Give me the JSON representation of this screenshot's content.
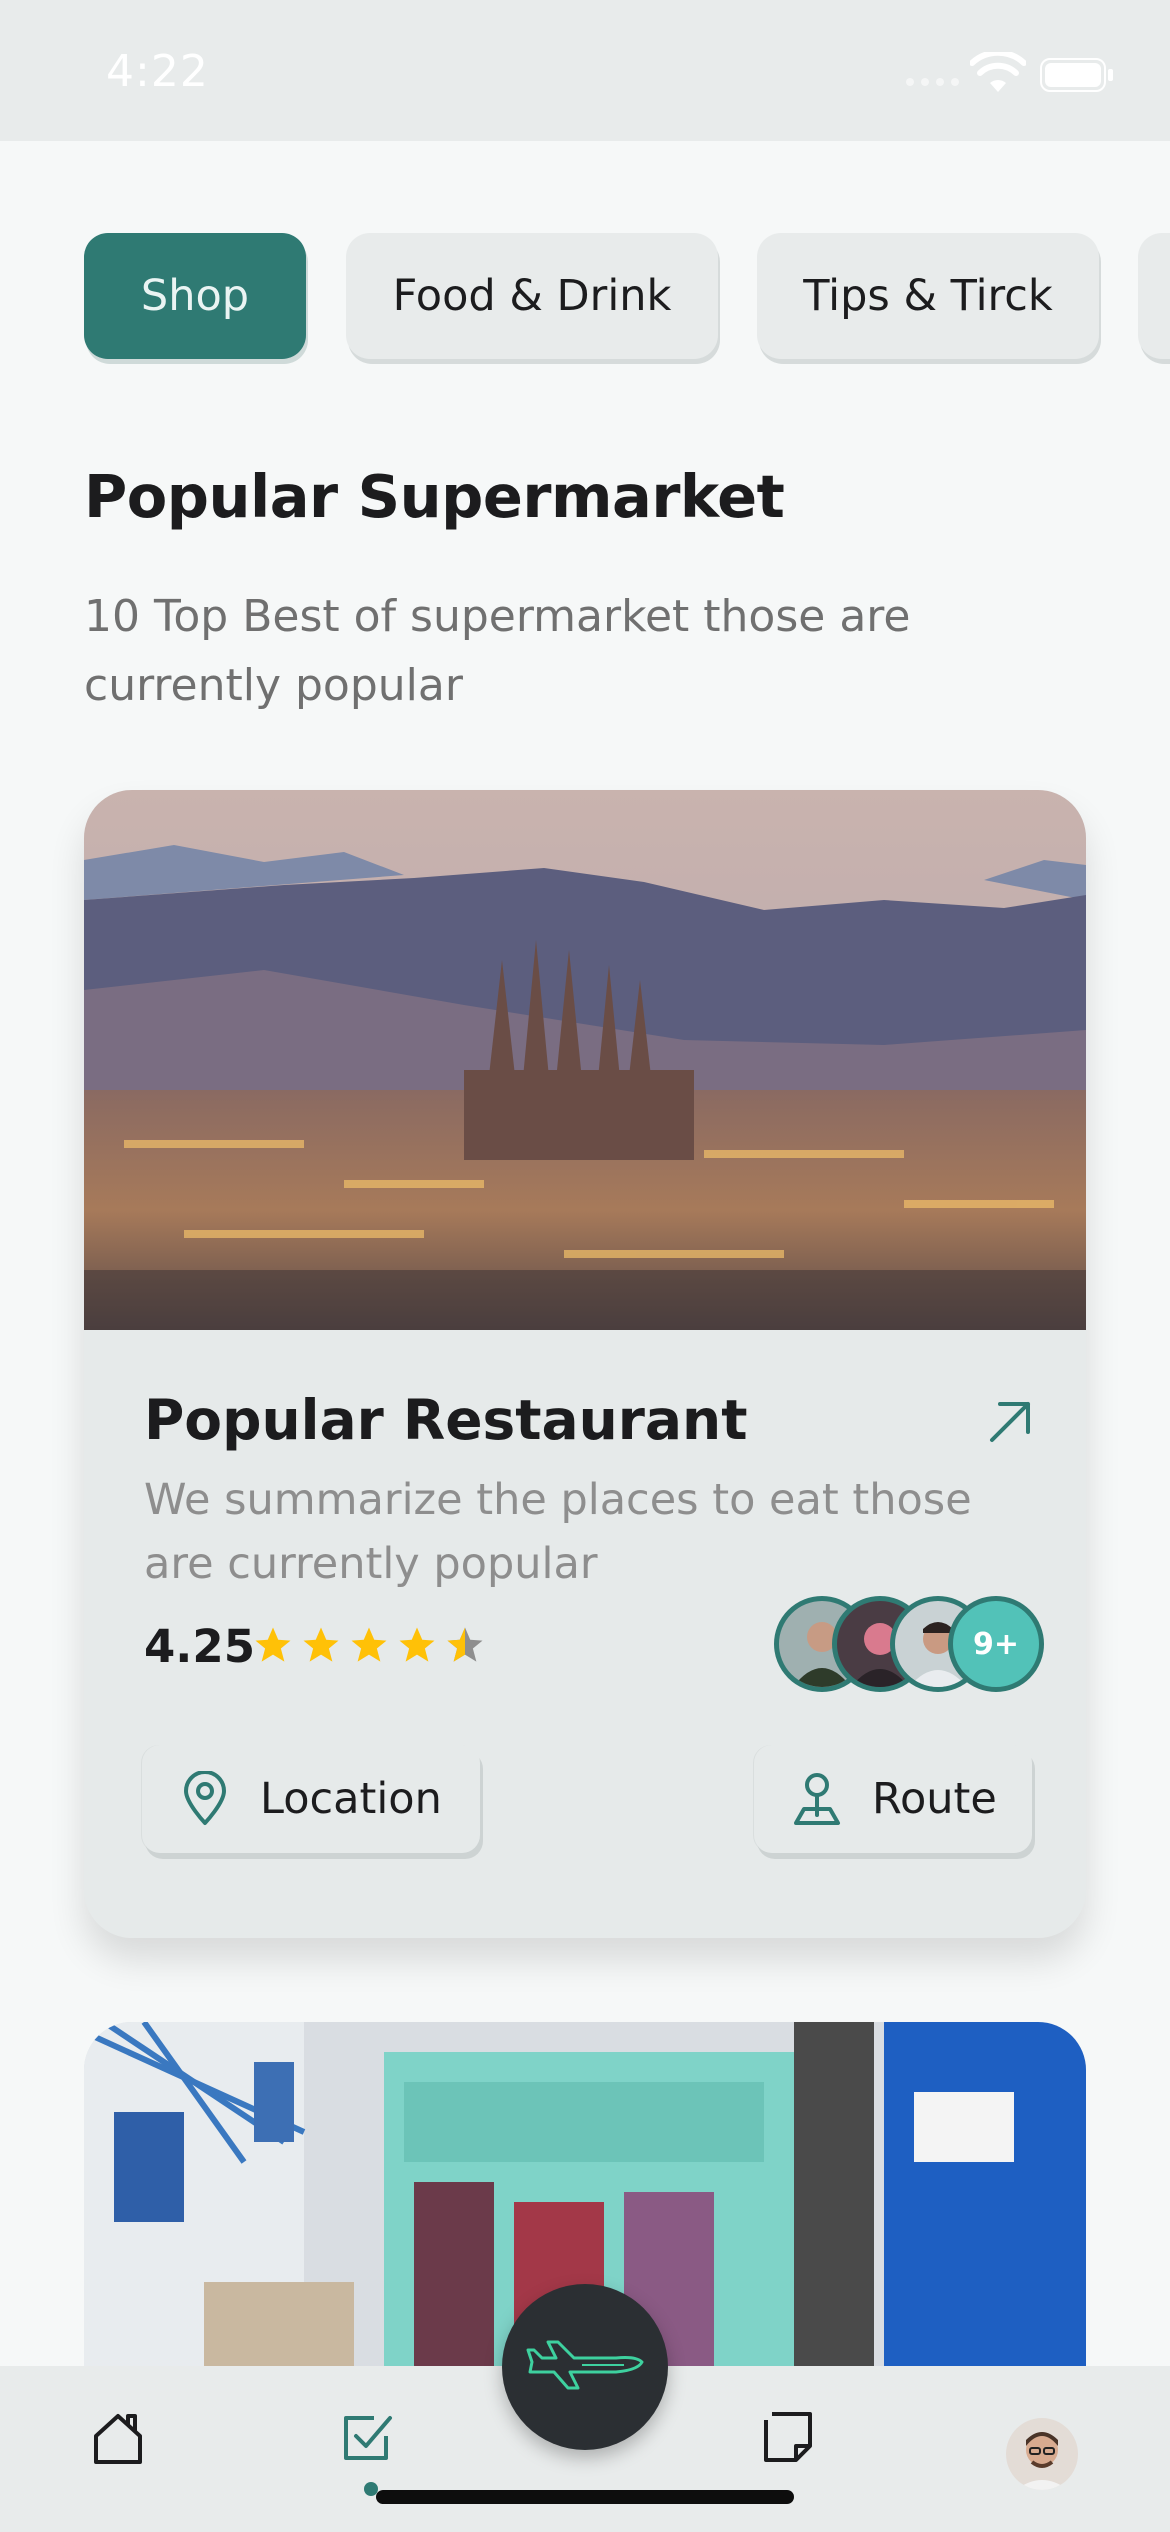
{
  "status_bar": {
    "time": "4:22"
  },
  "categories": [
    {
      "label": "Shop",
      "active": true
    },
    {
      "label": "Food & Drink",
      "active": false
    },
    {
      "label": "Tips & Tirck",
      "active": false
    }
  ],
  "section": {
    "title": "Popular Supermarket",
    "subtitle": "10 Top Best of supermarket those are currently popular"
  },
  "card": {
    "title": "Popular Restaurant",
    "description": "We summarize the places to eat those are currently popular",
    "rating": "4.25",
    "rating_stars": 4.5,
    "avatars_more": "9+",
    "location_label": "Location",
    "route_label": "Route"
  },
  "icons": {
    "open": "arrow-up-right-icon",
    "location": "map-pin-icon",
    "route": "route-pin-icon",
    "fab": "airplane-icon",
    "tabs": [
      "home-icon",
      "checkbox-icon",
      "notes-icon",
      "profile-avatar"
    ]
  },
  "colors": {
    "accent": "#2F7A73",
    "accent_light": "#52C2B8",
    "star": "#FFC107",
    "fab": "#2B2F33",
    "background": "#F6F8F8"
  }
}
